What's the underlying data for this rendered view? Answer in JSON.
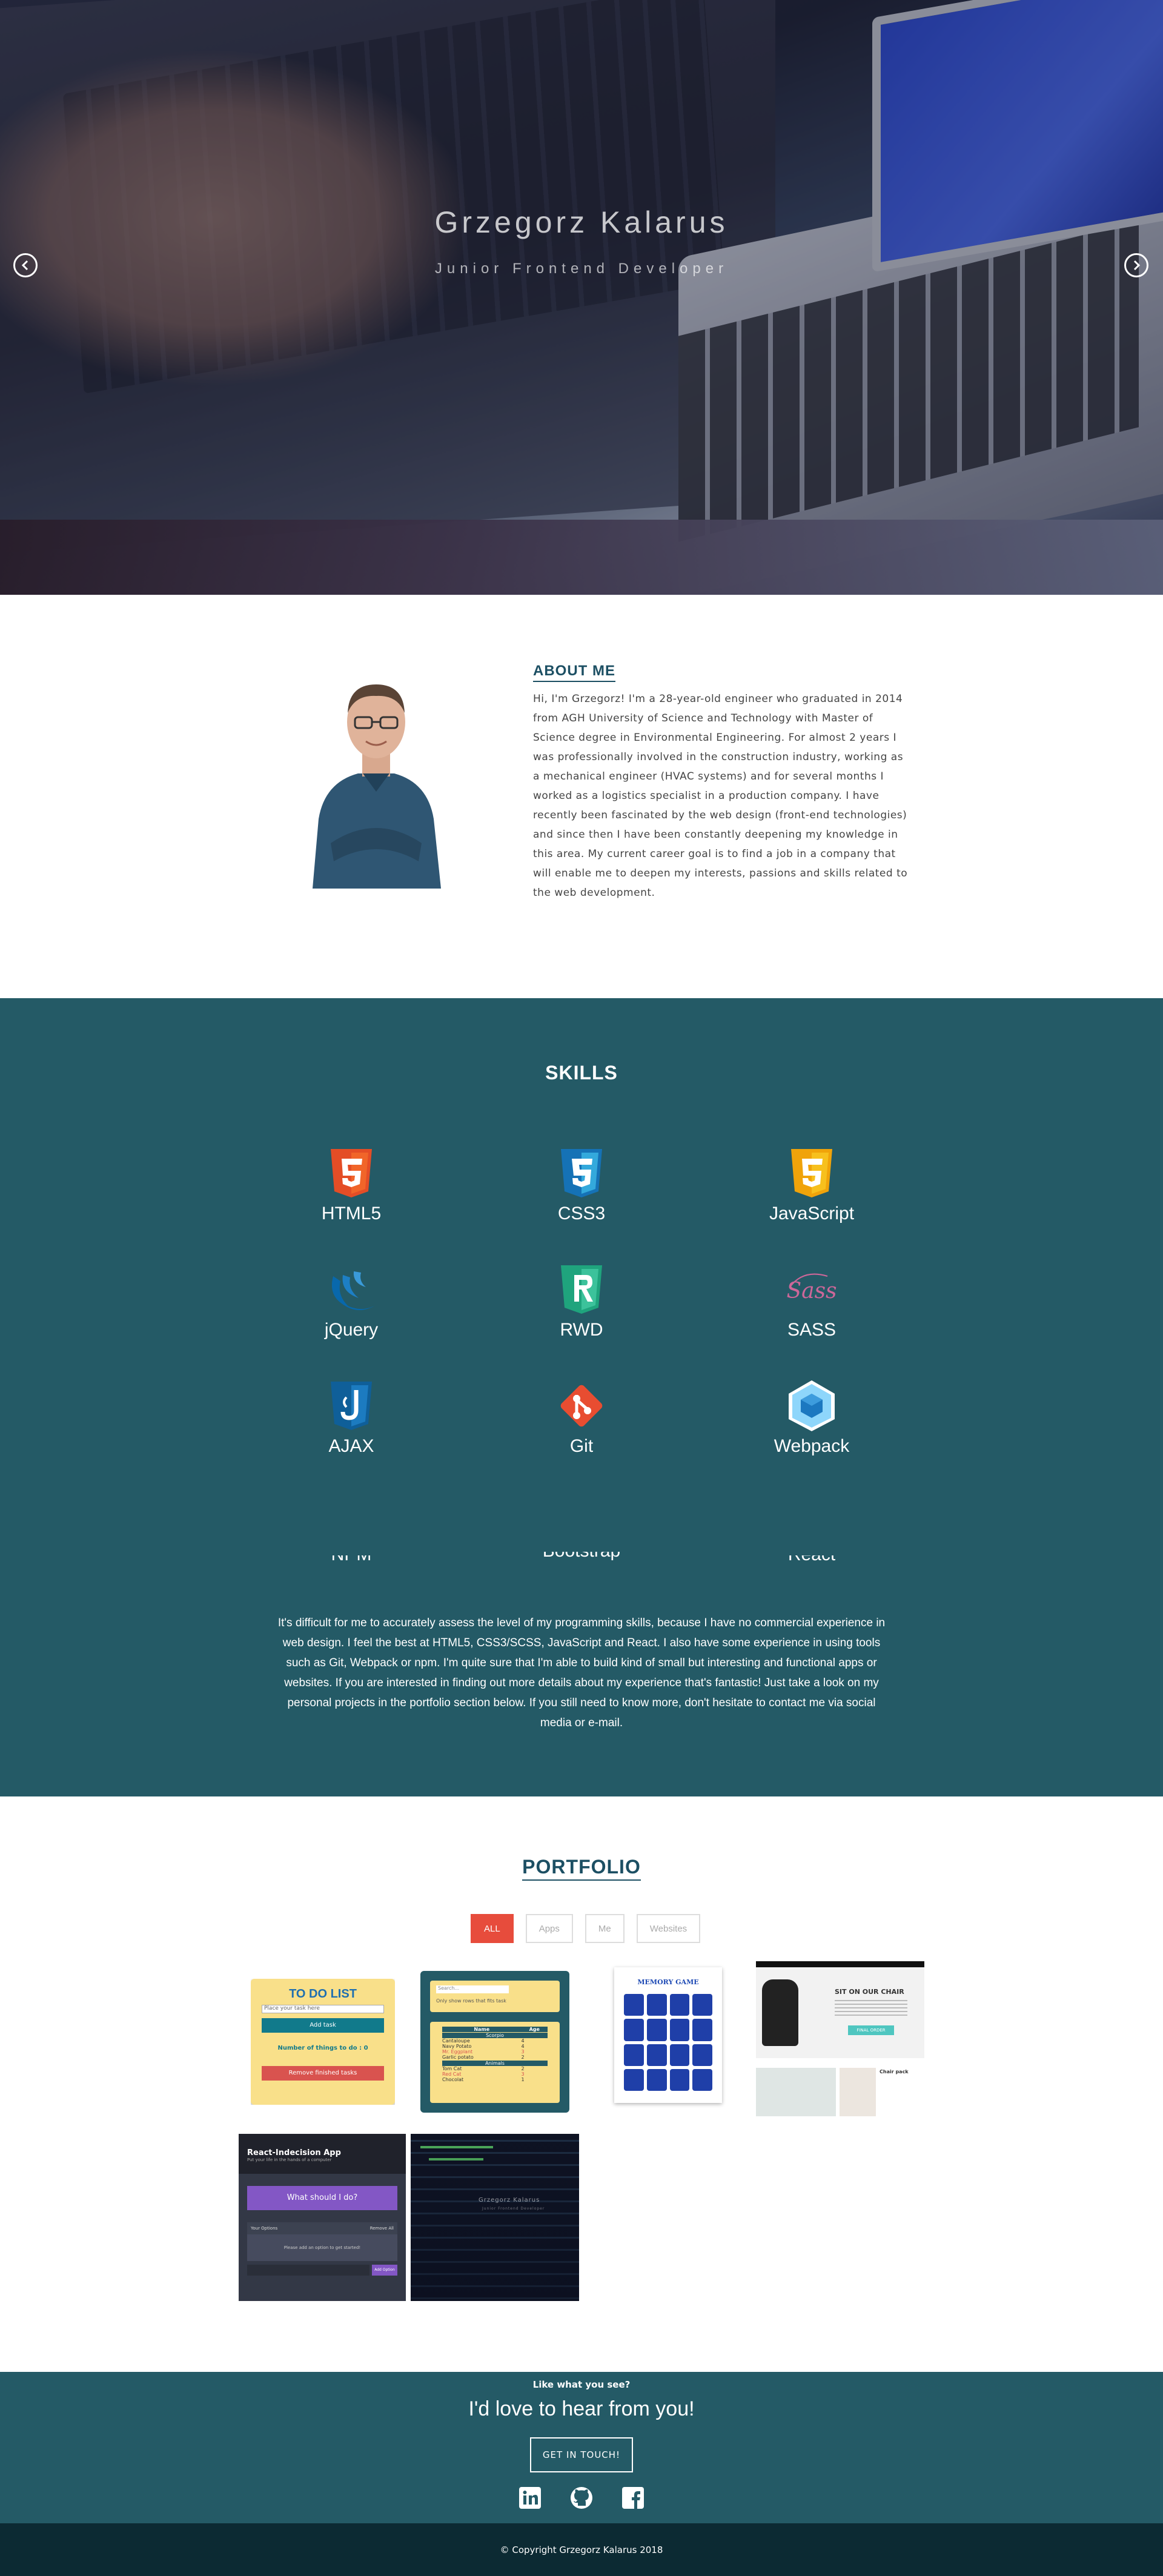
{
  "hero": {
    "title": "Grzegorz Kalarus",
    "subtitle": "Junior Frontend Developer",
    "prev_icon": "chevron-left-circle",
    "next_icon": "chevron-right-circle"
  },
  "about": {
    "heading": "ABOUT ME",
    "body": "Hi, I'm Grzegorz! I'm a 28-year-old engineer who graduated in 2014 from AGH University of Science and Technology with Master of Science degree in Environmental Engineering. For almost 2 years I was professionally involved in the construction industry, working as a mechanical engineer (HVAC systems) and for several months I worked as a logistics specialist in a production company. I have recently been fascinated by the web design (front-end technologies) and since then I have been constantly deepening my knowledge in this area. My current career goal is to find a job in a company that will enable me to deepen my interests, passions and skills related to the web development."
  },
  "skills": {
    "heading": "SKILLS",
    "items": [
      {
        "name": "HTML5",
        "icon": "html5-icon",
        "color": "#e44d26"
      },
      {
        "name": "CSS3",
        "icon": "css3-icon",
        "color": "#1572b6"
      },
      {
        "name": "JavaScript",
        "icon": "javascript-icon",
        "color": "#f0a30a"
      },
      {
        "name": "jQuery",
        "icon": "jquery-icon",
        "color": "#0868ac"
      },
      {
        "name": "RWD",
        "icon": "rwd-icon",
        "color": "#1fa47d"
      },
      {
        "name": "SASS",
        "icon": "sass-icon",
        "color": "#cd6799"
      },
      {
        "name": "AJAX",
        "icon": "ajax-icon",
        "color": "#0f5f99"
      },
      {
        "name": "Git",
        "icon": "git-icon",
        "color": "#e84d31"
      },
      {
        "name": "Webpack",
        "icon": "webpack-icon",
        "color": "#8ed6fb"
      },
      {
        "name": "NPM",
        "icon": "npm-icon",
        "color": "#cb3837"
      },
      {
        "name": "Bootstrap",
        "icon": "bootstrap-icon",
        "color": "#563d7c"
      },
      {
        "name": "React",
        "icon": "react-icon",
        "color": "#61dafb"
      }
    ],
    "description": "It's difficult for me to accurately assess the level of my programming skills, because I have no commercial experience in web design. I feel the best at HTML5, CSS3/SCSS, JavaScript and React. I also have some experience in using tools such as Git, Webpack or npm. I'm quite sure that I'm able to build kind of small but interesting and functional apps or websites. If you are interested in finding out more details about my experience that's fantastic! Just take a look on my personal projects in the portfolio section below. If you still need to know more, don't hesitate to contact me via social media or e-mail."
  },
  "portfolio": {
    "heading": "PORTFOLIO",
    "filters": [
      "ALL",
      "Apps",
      "Me",
      "Websites"
    ],
    "active_filter": "ALL",
    "projects": {
      "todo": {
        "title": "TO DO LIST",
        "placeholder": "Place your task here",
        "add_label": "Add task",
        "count_label": "Number of things to do : 0",
        "remove_label": "Remove finished tasks"
      },
      "table": {
        "search_placeholder": "Search...",
        "checkbox_label": "Only show rows that fits task",
        "col_name": "Name",
        "col_age": "Age",
        "group1": "Scorpio",
        "rows1": [
          [
            "Cantaloupe",
            "4"
          ],
          [
            "Navy Potato",
            "4"
          ],
          [
            "Mr. Eggplant",
            "3"
          ],
          [
            "Garlic potato",
            "2"
          ]
        ],
        "group2": "Animals",
        "rows2": [
          [
            "Tom Cat",
            "2"
          ],
          [
            "Red Cat",
            "3"
          ],
          [
            "Chocolat",
            "1"
          ]
        ]
      },
      "memory": {
        "title": "MEMORY GAME"
      },
      "chair": {
        "title": "SIT ON OUR CHAIR",
        "button": "FINAL ORDER",
        "caption": "Chair pack"
      },
      "indecision": {
        "title": "React-Indecision App",
        "subtitle": "Put your life in the hands of a computer",
        "button": "What should I do?",
        "options_label": "Your Options",
        "remove_all": "Remove All",
        "empty": "Please add an option to get started!",
        "add_button": "Add Option"
      },
      "code": {
        "overlay_title": "Grzegorz Kalarus",
        "overlay_sub": "Junior Frontend Developer"
      }
    }
  },
  "contact": {
    "eyebrow": "Like what you see?",
    "title": "I'd love to hear from you!",
    "button": "GET IN TOUCH!",
    "socials": [
      "linkedin-icon",
      "github-icon",
      "facebook-icon"
    ]
  },
  "footer": {
    "text": "© Copyright Grzegorz Kalarus 2018"
  }
}
